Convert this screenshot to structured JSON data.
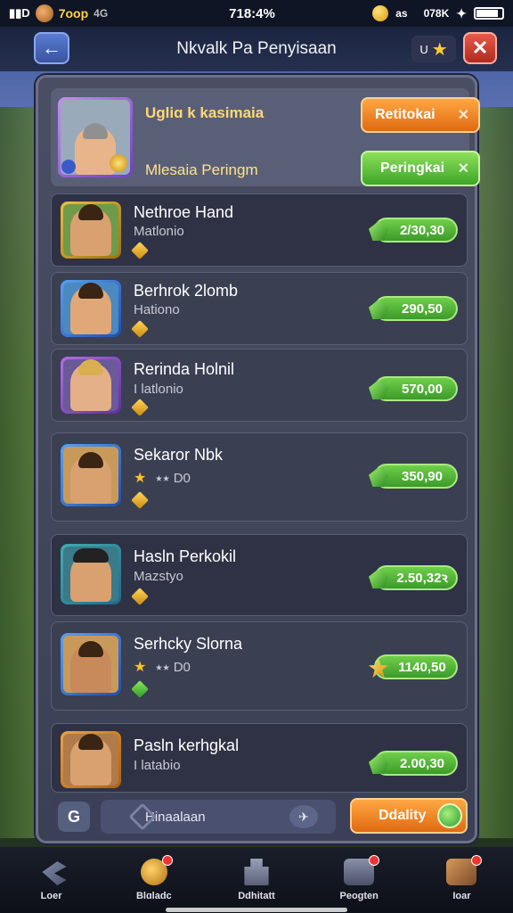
{
  "status_bar": {
    "app_text": "7oop",
    "app_text2": "4G",
    "time": "718:4%",
    "coin_text": "as",
    "battery_text": "078K"
  },
  "header": {
    "title": "Nkvalk Pa Penyisaan",
    "badge_text": "U"
  },
  "top_card": {
    "name": "Ugliɑ k kasimaia",
    "sub": "Mlesaia Peringm",
    "orange_button": "Retitokai",
    "green_button": "Peringkai"
  },
  "rows": [
    {
      "name": "Nethroe Hand",
      "sub": "Matlonio",
      "value": "2/30,30",
      "extra": ""
    },
    {
      "name": "Berhrok 2lomb",
      "sub": "Hationo",
      "value": "290,50",
      "extra": ""
    },
    {
      "name": "Rerinda Holnil",
      "sub": "I latlonio",
      "value": "570,00",
      "extra": ""
    },
    {
      "name": "Sekaror Nbk",
      "sub": "",
      "value": "350,90",
      "extra": "⭑⭑ D0"
    },
    {
      "name": "Hasln Perkokil",
      "sub": "Mazstyo",
      "value": "2.50,32ꝛ",
      "extra": ""
    },
    {
      "name": "Serhcky Slorna",
      "sub": "",
      "value": "1140,50",
      "extra": "⭑⭑ D0"
    },
    {
      "name": "Pasln kerhgkal",
      "sub": "I latabio",
      "value": "2.00,30",
      "extra": ""
    }
  ],
  "panel_bottom": {
    "search_text": "Hinaalaan",
    "action_button": "Ddality"
  },
  "nav": [
    {
      "label": "Loer"
    },
    {
      "label": "Blɑladc"
    },
    {
      "label": "Ddhitatt"
    },
    {
      "label": "Peogten"
    },
    {
      "label": "Ioar"
    }
  ]
}
